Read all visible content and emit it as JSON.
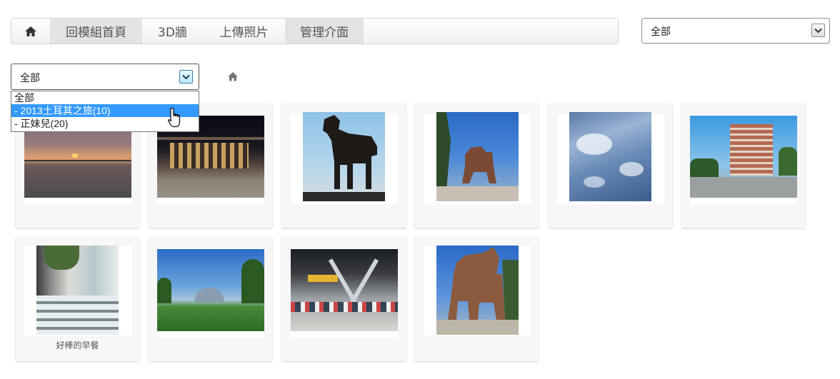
{
  "nav": {
    "home_icon": "home-icon",
    "items": [
      {
        "label": "回模組首頁",
        "active": true
      },
      {
        "label": "3D牆",
        "active": false
      },
      {
        "label": "上傳照片",
        "active": false
      },
      {
        "label": "管理介面",
        "active": true
      }
    ]
  },
  "top_select": {
    "value": "全部"
  },
  "album_select": {
    "value": "全部",
    "options": [
      "全部",
      "- 2013土耳其之旅(10)",
      "- 正妹兒(20)"
    ],
    "highlighted_index": 1
  },
  "breadcrumb_icon": "home-icon",
  "photos": [
    {
      "caption": ""
    },
    {
      "caption": ""
    },
    {
      "caption": ""
    },
    {
      "caption": ""
    },
    {
      "caption": ""
    },
    {
      "caption": ""
    },
    {
      "caption": "好棒的早餐"
    },
    {
      "caption": ""
    },
    {
      "caption": ""
    },
    {
      "caption": ""
    }
  ]
}
